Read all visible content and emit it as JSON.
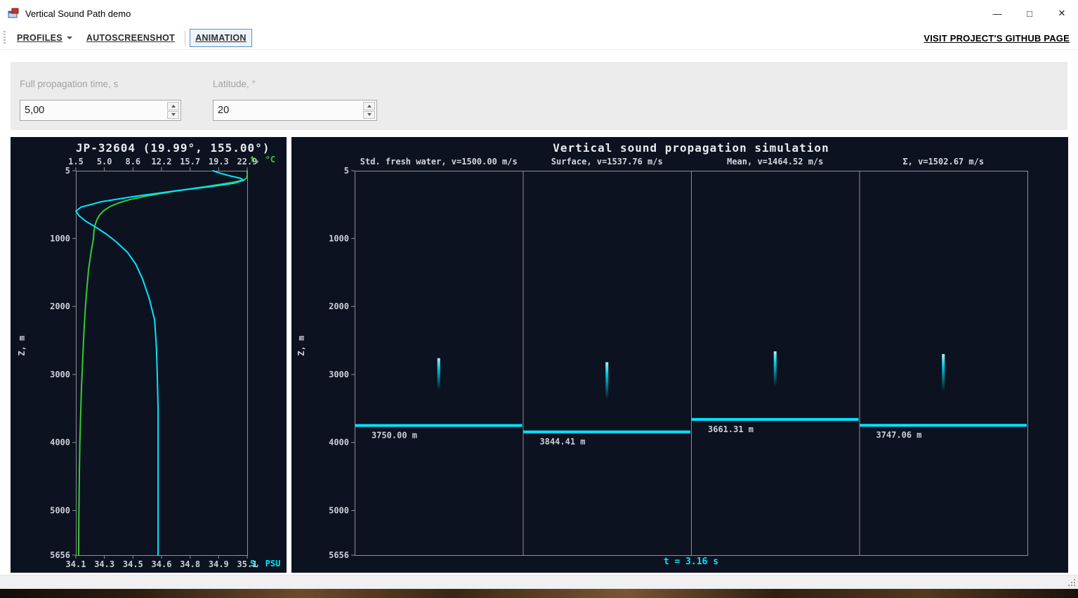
{
  "window": {
    "title": "Vertical Sound Path demo",
    "controls": {
      "minimize": "—",
      "maximize": "□",
      "close": "✕"
    }
  },
  "toolbar": {
    "profiles": "PROFILES",
    "autoscreenshot": "AUTOSCREENSHOT",
    "animation": "ANIMATION",
    "github_link": "VISIT PROJECT'S GITHUB PAGE"
  },
  "params": {
    "time": {
      "label": "Full propagation time, s",
      "value": "5,00"
    },
    "latitude": {
      "label": "Latitude, °",
      "value": "20"
    }
  },
  "profile_chart": {
    "title": "JP-32604 (19.99°, 155.00°)",
    "t_axis_label": "t, °C",
    "s_axis_label": "S, PSU",
    "z_axis_label": "Z, m",
    "t_ticks": [
      "1.5",
      "5.0",
      "8.6",
      "12.2",
      "15.7",
      "19.3",
      "22.9"
    ],
    "s_ticks": [
      "34.1",
      "34.3",
      "34.5",
      "34.6",
      "34.8",
      "34.9",
      "35.1"
    ],
    "z_ticks": [
      "5",
      "1000",
      "2000",
      "3000",
      "4000",
      "5000",
      "5656"
    ]
  },
  "sim_chart": {
    "title": "Vertical sound propagation simulation",
    "z_axis_label": "Z, m",
    "z_ticks": [
      "5",
      "1000",
      "2000",
      "3000",
      "4000",
      "5000",
      "5656"
    ],
    "time_label": "t = 3.16 s",
    "panels": [
      {
        "header": "Std. fresh water, v=1500.00 m/s",
        "depth_label": "3750.00 m"
      },
      {
        "header": "Surface, v=1537.76 m/s",
        "depth_label": "3844.41 m"
      },
      {
        "header": "Mean, v=1464.52 m/s",
        "depth_label": "3661.31 m"
      },
      {
        "header": "Σ, v=1502.67 m/s",
        "depth_label": "3747.06 m"
      }
    ]
  },
  "colors": {
    "cyan": "#00e5ff",
    "green": "#35cc35",
    "chart_bg": "#0d1220",
    "axis": "#8a8f98",
    "tick_text": "#c9ced6"
  },
  "chart_data": [
    {
      "type": "line",
      "title": "JP-32604 (19.99°, 155.00°)",
      "ylabel": "Z, m",
      "ylim": [
        5,
        5656
      ],
      "y_inverted": true,
      "series": [
        {
          "name": "t, °C",
          "color": "#35cc35",
          "xlim": [
            1.5,
            22.9
          ],
          "points": [
            [
              22.9,
              5
            ],
            [
              22.9,
              70
            ],
            [
              22.85,
              110
            ],
            [
              22.5,
              140
            ],
            [
              21.3,
              170
            ],
            [
              19.8,
              200
            ],
            [
              17.6,
              240
            ],
            [
              15.2,
              280
            ],
            [
              12.6,
              330
            ],
            [
              10.2,
              380
            ],
            [
              8.2,
              430
            ],
            [
              6.8,
              480
            ],
            [
              5.8,
              530
            ],
            [
              5.0,
              590
            ],
            [
              4.5,
              650
            ],
            [
              4.15,
              720
            ],
            [
              3.9,
              800
            ],
            [
              3.75,
              900
            ],
            [
              3.7,
              1000
            ],
            [
              3.4,
              1200
            ],
            [
              3.1,
              1450
            ],
            [
              2.9,
              1700
            ],
            [
              2.7,
              2000
            ],
            [
              2.5,
              2400
            ],
            [
              2.35,
              2800
            ],
            [
              2.2,
              3200
            ],
            [
              2.1,
              3600
            ],
            [
              2.0,
              4000
            ],
            [
              1.95,
              4400
            ],
            [
              1.9,
              4800
            ],
            [
              1.87,
              5200
            ],
            [
              1.85,
              5656
            ]
          ]
        },
        {
          "name": "S, PSU",
          "color": "#00e5ff",
          "xlim": [
            34.1,
            35.1
          ],
          "points": [
            [
              34.9,
              5
            ],
            [
              34.94,
              40
            ],
            [
              35.0,
              80
            ],
            [
              35.06,
              115
            ],
            [
              35.08,
              145
            ],
            [
              35.02,
              190
            ],
            [
              34.88,
              240
            ],
            [
              34.68,
              300
            ],
            [
              34.45,
              380
            ],
            [
              34.25,
              460
            ],
            [
              34.13,
              540
            ],
            [
              34.1,
              600
            ],
            [
              34.12,
              670
            ],
            [
              34.16,
              750
            ],
            [
              34.22,
              840
            ],
            [
              34.28,
              940
            ],
            [
              34.34,
              1060
            ],
            [
              34.4,
              1200
            ],
            [
              34.45,
              1380
            ],
            [
              34.49,
              1600
            ],
            [
              34.53,
              1900
            ],
            [
              34.56,
              2200
            ],
            [
              34.57,
              2600
            ],
            [
              34.575,
              3000
            ],
            [
              34.58,
              3500
            ],
            [
              34.58,
              4000
            ],
            [
              34.58,
              4500
            ],
            [
              34.58,
              5000
            ],
            [
              34.58,
              5656
            ]
          ]
        }
      ]
    },
    {
      "type": "line",
      "title": "Vertical sound propagation simulation",
      "ylabel": "Z, m",
      "ylim": [
        5,
        5656
      ],
      "y_inverted": true,
      "time_s": 3.16,
      "panels": [
        {
          "name": "Std. fresh water",
          "velocity_ms": 1500.0,
          "front_depth_m": 3750.0,
          "pulse_z": [
            2760,
            3230
          ]
        },
        {
          "name": "Surface",
          "velocity_ms": 1537.76,
          "front_depth_m": 3844.41,
          "pulse_z": [
            2820,
            3360
          ]
        },
        {
          "name": "Mean",
          "velocity_ms": 1464.52,
          "front_depth_m": 3661.31,
          "pulse_z": [
            2660,
            3180
          ]
        },
        {
          "name": "Σ",
          "velocity_ms": 1502.67,
          "front_depth_m": 3747.06,
          "pulse_z": [
            2700,
            3250
          ]
        }
      ]
    }
  ]
}
